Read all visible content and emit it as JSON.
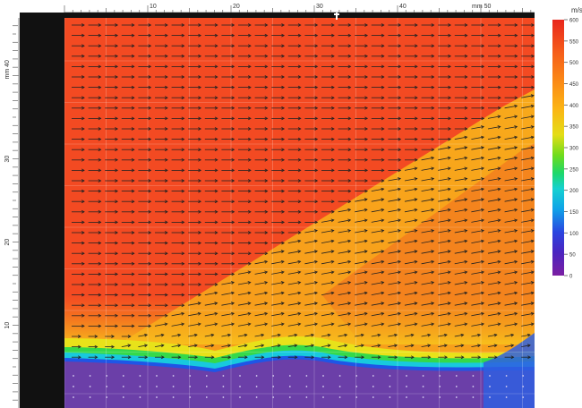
{
  "ruler_top": {
    "unit": "mm",
    "ticks": [
      {
        "value": 10,
        "label": "10"
      },
      {
        "value": 20,
        "label": "20"
      },
      {
        "value": 30,
        "label": "30"
      },
      {
        "value": 40,
        "label": "40"
      },
      {
        "value": 50,
        "label": "50"
      }
    ]
  },
  "ruler_left": {
    "unit": "mm",
    "ticks": [
      {
        "value": 40,
        "label": "40"
      },
      {
        "value": 30,
        "label": "30"
      },
      {
        "value": 20,
        "label": "20"
      },
      {
        "value": 10,
        "label": "10"
      }
    ]
  },
  "colorbar": {
    "unit": "m/s",
    "ticks": [
      "600",
      "550",
      "500",
      "450",
      "400",
      "350",
      "300",
      "250",
      "200",
      "150",
      "100",
      "50",
      "0"
    ],
    "colors": [
      "#7a1fa2",
      "#2b2bd6",
      "#0fa0e8",
      "#17d3cf",
      "#20dd3a",
      "#b8e21c",
      "#f4d316",
      "#fba214",
      "#fb6a1a",
      "#f23a1c"
    ]
  },
  "field": {
    "background_color": "#f34a22",
    "boundary_color": "#6b3fa8"
  }
}
